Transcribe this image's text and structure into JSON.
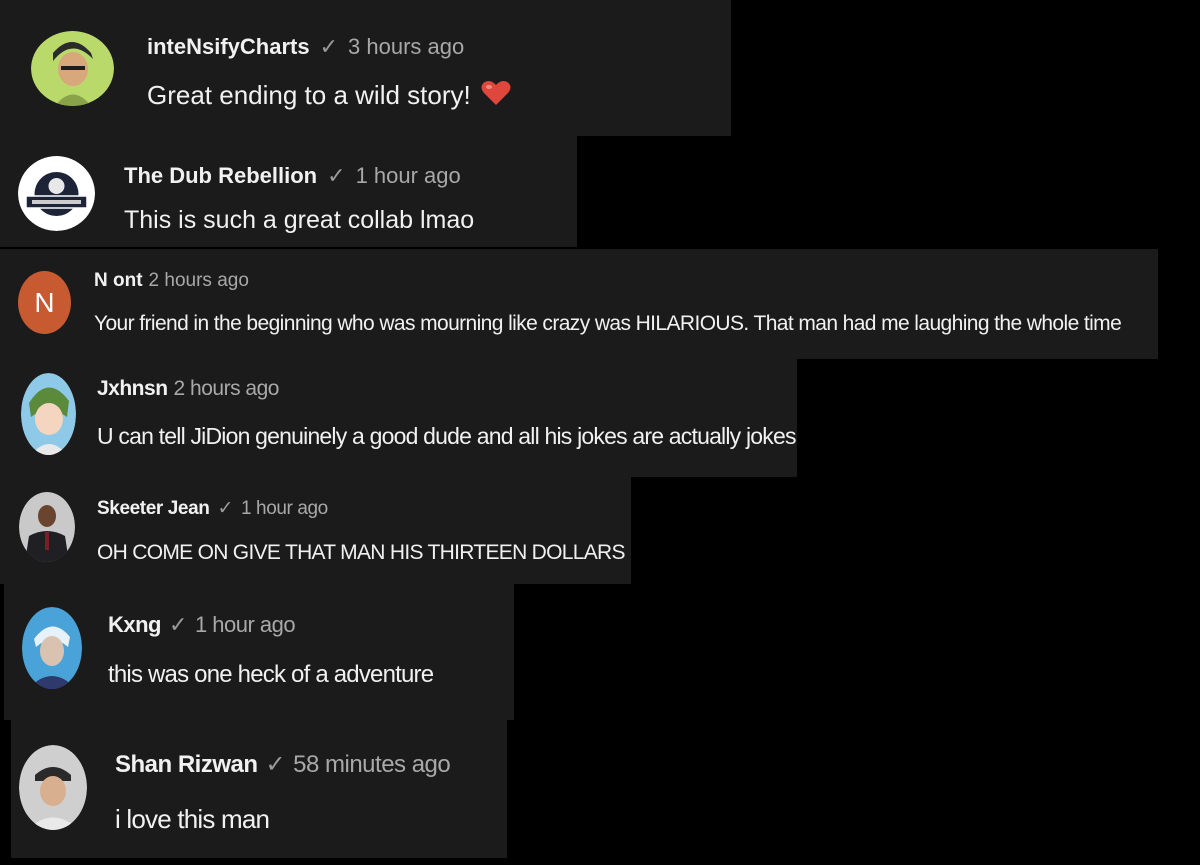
{
  "comments": [
    {
      "author": "inteNsifyCharts",
      "verified": true,
      "time": "3 hours ago",
      "text": "Great ending to a wild story!",
      "emoji": "heart-icon",
      "avatar": "cartoon-avatar"
    },
    {
      "author": "The Dub Rebellion",
      "verified": true,
      "time": "1 hour ago",
      "text": "This is such a great collab lmao",
      "avatar": "logo-avatar"
    },
    {
      "author": "N ont",
      "verified": false,
      "time": "2 hours ago",
      "text": "Your friend in the beginning who was mourning like crazy was HILARIOUS. That man had me laughing the whole time",
      "avatar_letter": "N",
      "avatar_color": "#c75a30"
    },
    {
      "author": "Jxhnsn",
      "verified": false,
      "time": "2 hours ago",
      "text": "U can tell JiDion genuinely a good dude and all his jokes are actually jokes",
      "avatar": "anime-avatar"
    },
    {
      "author": "Skeeter Jean",
      "verified": true,
      "time": "1 hour ago",
      "text": "OH COME ON GIVE THAT MAN HIS THIRTEEN DOLLARS",
      "avatar": "photo-avatar"
    },
    {
      "author": "Kxng",
      "verified": true,
      "time": "1 hour ago",
      "text": "this was one heck of a adventure",
      "avatar": "illustrated-avatar"
    },
    {
      "author": "Shan Rizwan",
      "verified": true,
      "time": "58 minutes ago",
      "text": "i love this man",
      "avatar": "photo-avatar"
    }
  ],
  "colors": {
    "card_bg": "#1b1b1b",
    "page_bg": "#000000",
    "heart": "#e0473c"
  },
  "check_glyph": "✓"
}
